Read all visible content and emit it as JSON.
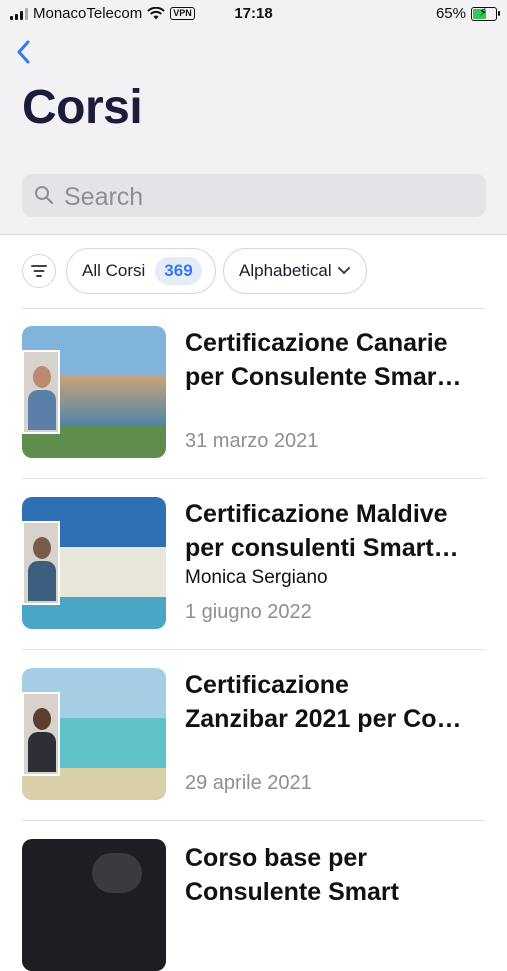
{
  "status_bar": {
    "carrier": "MonacoTelecom",
    "vpn": "VPN",
    "time": "17:18",
    "battery": "65%",
    "battery_level": 0.65
  },
  "header": {
    "back_icon": "chevron-left-icon",
    "title": "Corsi",
    "search_placeholder": "Search"
  },
  "filters": {
    "all_label": "All Corsi",
    "all_count": "369",
    "sort_label": "Alphabetical"
  },
  "colors": {
    "accent": "#3478f6",
    "title": "#1b1b3a",
    "secondary_text": "#8e8e93",
    "header_bg": "#f2f2f4"
  },
  "courses": [
    {
      "title_line1": "Certificazione Canarie",
      "title_line2": "per Consulente Smar…",
      "author": "",
      "date": "31 marzo 2021"
    },
    {
      "title_line1": "Certificazione Maldive",
      "title_line2": "per consulenti Smart…",
      "author": "Monica Sergiano",
      "date": "1 giugno 2022"
    },
    {
      "title_line1": "Certificazione",
      "title_line2": "Zanzibar 2021 per Co…",
      "author": "",
      "date": "29 aprile 2021"
    },
    {
      "title_line1": "Corso base per",
      "title_line2": "Consulente Smart",
      "author": "",
      "date": ""
    }
  ]
}
